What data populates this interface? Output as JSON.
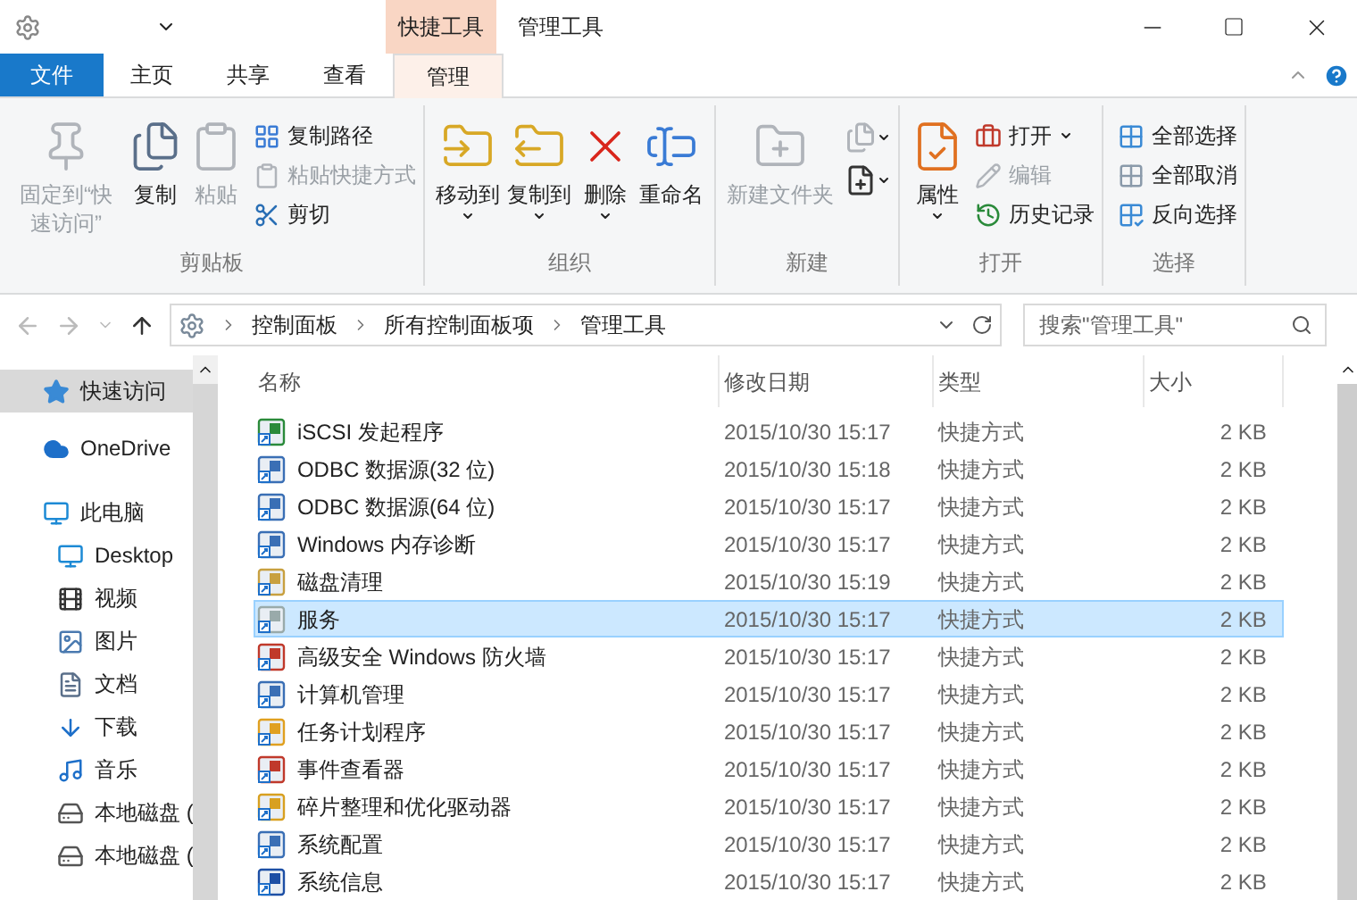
{
  "title_bar": {
    "context_group": "快捷工具",
    "title": "管理工具"
  },
  "ribbon_tabs": [
    {
      "label": "文件",
      "kind": "file",
      "selected": false
    },
    {
      "label": "主页",
      "kind": "normal",
      "selected": false
    },
    {
      "label": "共享",
      "kind": "normal",
      "selected": false
    },
    {
      "label": "查看",
      "kind": "normal",
      "selected": false
    },
    {
      "label": "管理",
      "kind": "context",
      "selected": true
    }
  ],
  "ribbon_groups": [
    {
      "label": "剪贴板",
      "commands": [
        {
          "label": "固定到“快速访问”",
          "kind": "large",
          "disabled": true,
          "dropdown": false
        },
        {
          "label": "复制",
          "kind": "large",
          "disabled": false,
          "dropdown": false
        },
        {
          "label": "粘贴",
          "kind": "large",
          "disabled": true,
          "dropdown": false
        },
        {
          "label": "复制路径",
          "kind": "small",
          "disabled": false,
          "dropdown": false
        },
        {
          "label": "粘贴快捷方式",
          "kind": "small",
          "disabled": true,
          "dropdown": false
        },
        {
          "label": "剪切",
          "kind": "small",
          "disabled": false,
          "dropdown": false
        }
      ]
    },
    {
      "label": "组织",
      "commands": [
        {
          "label": "移动到",
          "kind": "large",
          "disabled": false,
          "dropdown": true
        },
        {
          "label": "复制到",
          "kind": "large",
          "disabled": false,
          "dropdown": true
        },
        {
          "label": "删除",
          "kind": "large",
          "disabled": false,
          "dropdown": true
        },
        {
          "label": "重命名",
          "kind": "large",
          "disabled": false,
          "dropdown": false
        }
      ]
    },
    {
      "label": "新建",
      "commands": [
        {
          "label": "新建文件夹",
          "kind": "large",
          "disabled": true,
          "dropdown": false
        },
        {
          "kind": "icon",
          "disabled": true,
          "dropdown": true
        },
        {
          "kind": "icon",
          "disabled": false,
          "dropdown": true
        }
      ]
    },
    {
      "label": "打开",
      "commands": [
        {
          "label": "属性",
          "kind": "large",
          "disabled": false,
          "dropdown": true
        },
        {
          "label": "打开",
          "kind": "small",
          "disabled": false,
          "dropdown": true
        },
        {
          "label": "编辑",
          "kind": "small",
          "disabled": true,
          "dropdown": false
        },
        {
          "label": "历史记录",
          "kind": "small",
          "disabled": false,
          "dropdown": false
        }
      ]
    },
    {
      "label": "选择",
      "commands": [
        {
          "label": "全部选择",
          "kind": "small",
          "disabled": false,
          "dropdown": false
        },
        {
          "label": "全部取消",
          "kind": "small",
          "disabled": false,
          "dropdown": false
        },
        {
          "label": "反向选择",
          "kind": "small",
          "disabled": false,
          "dropdown": false
        }
      ]
    }
  ],
  "address_bar": {
    "breadcrumbs": [
      "控制面板",
      "所有控制面板项",
      "管理工具"
    ]
  },
  "search": {
    "placeholder": "搜索\"管理工具\""
  },
  "sidebar": {
    "items": [
      {
        "label": "快速访问",
        "selected": true
      },
      {
        "label": "OneDrive",
        "selected": false
      },
      {
        "label": "此电脑",
        "selected": false,
        "children": [
          {
            "label": "Desktop",
            "selected": false
          },
          {
            "label": "视频",
            "selected": false
          },
          {
            "label": "图片",
            "selected": false
          },
          {
            "label": "文档",
            "selected": false
          },
          {
            "label": "下载",
            "selected": false
          },
          {
            "label": "音乐",
            "selected": false
          },
          {
            "label": "本地磁盘 (",
            "selected": false
          },
          {
            "label": "本地磁盘 (",
            "selected": false
          }
        ]
      }
    ]
  },
  "table": {
    "columns": [
      "名称",
      "修改日期",
      "类型",
      "大小"
    ],
    "rows": [
      {
        "name": "iSCSI 发起程序",
        "date": "2015/10/30 15:17",
        "type": "快捷方式",
        "size": "2 KB",
        "selected": false
      },
      {
        "name": "ODBC 数据源(32 位)",
        "date": "2015/10/30 15:18",
        "type": "快捷方式",
        "size": "2 KB",
        "selected": false
      },
      {
        "name": "ODBC 数据源(64 位)",
        "date": "2015/10/30 15:17",
        "type": "快捷方式",
        "size": "2 KB",
        "selected": false
      },
      {
        "name": "Windows 内存诊断",
        "date": "2015/10/30 15:17",
        "type": "快捷方式",
        "size": "2 KB",
        "selected": false
      },
      {
        "name": "磁盘清理",
        "date": "2015/10/30 15:19",
        "type": "快捷方式",
        "size": "2 KB",
        "selected": false
      },
      {
        "name": "服务",
        "date": "2015/10/30 15:17",
        "type": "快捷方式",
        "size": "2 KB",
        "selected": true
      },
      {
        "name": "高级安全 Windows 防火墙",
        "date": "2015/10/30 15:17",
        "type": "快捷方式",
        "size": "2 KB",
        "selected": false
      },
      {
        "name": "计算机管理",
        "date": "2015/10/30 15:17",
        "type": "快捷方式",
        "size": "2 KB",
        "selected": false
      },
      {
        "name": "任务计划程序",
        "date": "2015/10/30 15:17",
        "type": "快捷方式",
        "size": "2 KB",
        "selected": false
      },
      {
        "name": "事件查看器",
        "date": "2015/10/30 15:17",
        "type": "快捷方式",
        "size": "2 KB",
        "selected": false
      },
      {
        "name": "碎片整理和优化驱动器",
        "date": "2015/10/30 15:17",
        "type": "快捷方式",
        "size": "2 KB",
        "selected": false
      },
      {
        "name": "系统配置",
        "date": "2015/10/30 15:17",
        "type": "快捷方式",
        "size": "2 KB",
        "selected": false
      },
      {
        "name": "系统信息",
        "date": "2015/10/30 15:17",
        "type": "快捷方式",
        "size": "2 KB",
        "selected": false
      }
    ]
  }
}
